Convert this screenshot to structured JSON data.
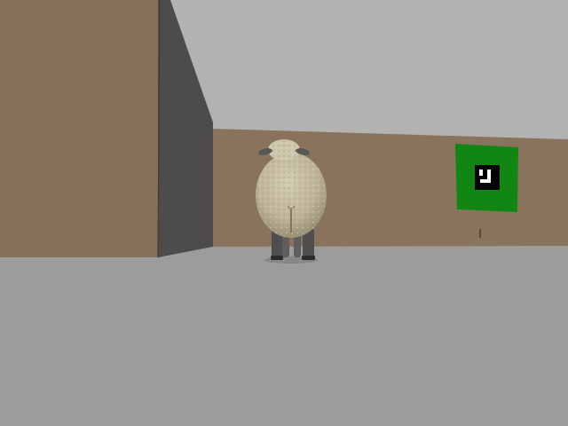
{
  "scene": {
    "type": "first-person 3D maze view",
    "colors": {
      "sky": "#b2b2b2",
      "floor": "#9c9c9c",
      "wall_brown": "#85705c",
      "wall_brown_far": "#8a735d",
      "wall_shadow": "#4e4c4a",
      "sign_green": "#128612",
      "marker_black": "#000000",
      "marker_white": "#ffffff",
      "sheep_wool": "#c6bea2",
      "sheep_legs": "#4f4d4e"
    },
    "objects": {
      "sheep": {
        "icon": "sheep-icon",
        "view": "rear"
      },
      "sign": {
        "icon": "fiducial-marker-icon",
        "color": "green"
      }
    }
  }
}
